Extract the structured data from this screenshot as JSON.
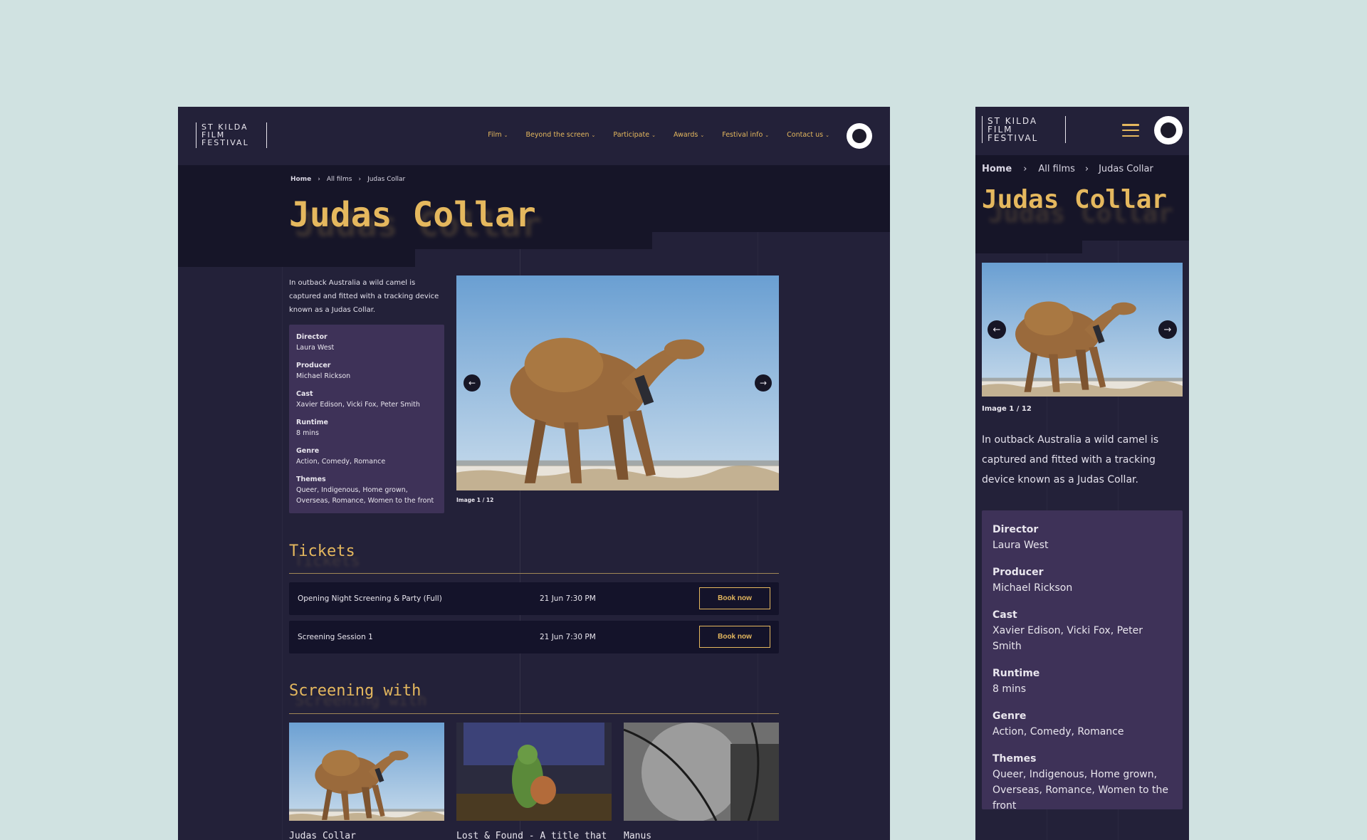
{
  "brand": {
    "logo_lines": [
      "ST KILDA",
      "FILM",
      "FESTIVAL"
    ]
  },
  "nav": {
    "items": [
      {
        "label": "Film"
      },
      {
        "label": "Beyond the screen"
      },
      {
        "label": "Participate"
      },
      {
        "label": "Awards"
      },
      {
        "label": "Festival info"
      },
      {
        "label": "Contact us"
      }
    ]
  },
  "breadcrumb": {
    "home": "Home",
    "all_films": "All films",
    "current": "Judas Collar"
  },
  "film": {
    "title": "Judas Collar",
    "description": "In outback Australia a wild camel is captured and fitted with a tracking device known as a Judas Collar.",
    "meta": {
      "director_label": "Director",
      "director": "Laura West",
      "producer_label": "Producer",
      "producer": "Michael Rickson",
      "cast_label": "Cast",
      "cast": "Xavier Edison, Vicki Fox, Peter Smith",
      "runtime_label": "Runtime",
      "runtime": "8 mins",
      "genre_label": "Genre",
      "genre": "Action, Comedy, Romance",
      "themes_label": "Themes",
      "themes": "Queer, Indigenous, Home grown, Overseas, Romance, Women to the front"
    },
    "gallery": {
      "caption": "Image 1 / 12",
      "current": 1,
      "total": 12
    }
  },
  "tickets": {
    "heading": "Tickets",
    "rows": [
      {
        "name": "Opening Night Screening & Party (Full)",
        "date": "21 Jun 7:30 PM",
        "button": "Book now"
      },
      {
        "name": "Screening Session 1",
        "date": "21 Jun 7:30 PM",
        "button": "Book now"
      }
    ]
  },
  "screening_with": {
    "heading": "Screening with",
    "films": [
      {
        "title": "Judas Collar"
      },
      {
        "title": "Lost & Found - A title that"
      },
      {
        "title": "Manus"
      }
    ]
  },
  "colors": {
    "background": "#d0e2e1",
    "panel": "#232139",
    "accent": "#e5b85e",
    "meta_panel": "#3e3258"
  },
  "icons": [
    "chevron-down-icon",
    "chevron-right-icon",
    "arrow-left-icon",
    "arrow-right-icon",
    "menu-icon",
    "festival-seal-icon"
  ]
}
